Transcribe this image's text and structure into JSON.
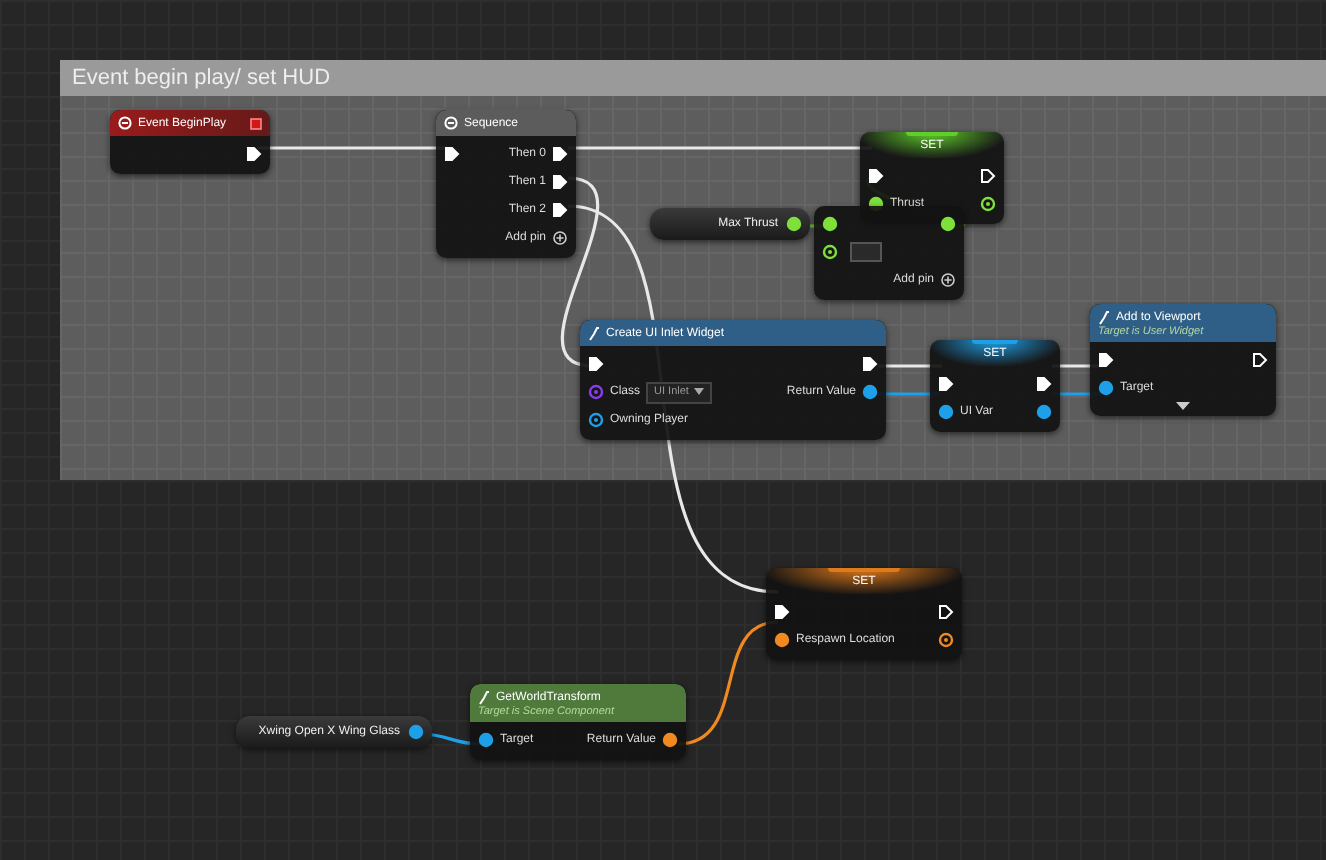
{
  "comment": {
    "title": "Event begin play/ set HUD"
  },
  "nodes": [
    {
      "kind": "event",
      "title": "Event BeginPlay",
      "color": "#9a1b1b",
      "outputs": [
        {
          "kind": "exec",
          "connected": true
        }
      ]
    },
    {
      "kind": "flow",
      "title": "Sequence",
      "color": "#5c5c5c",
      "inputs": [
        {
          "kind": "exec",
          "connected": true
        }
      ],
      "outputs": [
        {
          "kind": "exec",
          "label": "Then 0",
          "connected": true
        },
        {
          "kind": "exec",
          "label": "Then 1",
          "connected": true
        },
        {
          "kind": "exec",
          "label": "Then 2",
          "connected": true
        }
      ],
      "footer": "Add pin"
    },
    {
      "kind": "set",
      "title": "SET",
      "color": "#5fcf2a",
      "inputs": [
        {
          "kind": "exec",
          "connected": true
        },
        {
          "kind": "data",
          "label": "Thrust",
          "color": "#7ee03a",
          "connected": true
        }
      ],
      "outputs": [
        {
          "kind": "exec",
          "connected": false
        },
        {
          "kind": "data",
          "color": "#7ee03a",
          "connected": false
        }
      ]
    },
    {
      "kind": "variable",
      "title": "Max Thrust",
      "outputs": [
        {
          "kind": "data",
          "color": "#7ee03a",
          "connected": true
        }
      ]
    },
    {
      "kind": "math",
      "inputs": [
        {
          "kind": "data",
          "color": "#7ee03a",
          "connected": true
        },
        {
          "kind": "data",
          "color": "#7ee03a",
          "connected": false,
          "field": true
        }
      ],
      "outputs": [
        {
          "kind": "data",
          "color": "#7ee03a",
          "connected": true
        }
      ],
      "footer": "Add pin"
    },
    {
      "kind": "function",
      "title": "Create UI Inlet Widget",
      "color": "#2f5f86",
      "inputs": [
        {
          "kind": "exec",
          "connected": true
        },
        {
          "kind": "data",
          "label": "Class",
          "color": "#8a3cf0",
          "connected": false,
          "value": "UI Inlet"
        },
        {
          "kind": "data",
          "label": "Owning Player",
          "color": "#1ea0e8",
          "connected": false
        }
      ],
      "outputs": [
        {
          "kind": "exec",
          "connected": true
        },
        {
          "kind": "data",
          "label": "Return Value",
          "color": "#1ea0e8",
          "connected": true
        }
      ]
    },
    {
      "kind": "set",
      "title": "SET",
      "color": "#1ea0e8",
      "inputs": [
        {
          "kind": "exec",
          "connected": true
        },
        {
          "kind": "data",
          "label": "UI Var",
          "color": "#1ea0e8",
          "connected": true
        }
      ],
      "outputs": [
        {
          "kind": "exec",
          "connected": true
        },
        {
          "kind": "data",
          "color": "#1ea0e8",
          "connected": true
        }
      ]
    },
    {
      "kind": "function",
      "title": "Add to Viewport",
      "subtitle": "Target is User Widget",
      "color": "#2f5f86",
      "inputs": [
        {
          "kind": "exec",
          "connected": true
        },
        {
          "kind": "data",
          "label": "Target",
          "color": "#1ea0e8",
          "connected": true
        }
      ],
      "outputs": [
        {
          "kind": "exec",
          "connected": false
        }
      ],
      "expander": true
    },
    {
      "kind": "set",
      "title": "SET",
      "color": "#e07a1a",
      "inputs": [
        {
          "kind": "exec",
          "connected": true
        },
        {
          "kind": "data",
          "label": "Respawn Location",
          "color": "#f08a20",
          "connected": true
        }
      ],
      "outputs": [
        {
          "kind": "exec",
          "connected": false
        },
        {
          "kind": "data",
          "color": "#f08a20",
          "connected": false
        }
      ]
    },
    {
      "kind": "function",
      "title": "GetWorldTransform",
      "subtitle": "Target is Scene Component",
      "color": "#4f7a3c",
      "inputs": [
        {
          "kind": "data",
          "label": "Target",
          "color": "#1ea0e8",
          "connected": true
        }
      ],
      "outputs": [
        {
          "kind": "data",
          "label": "Return Value",
          "color": "#f08a20",
          "connected": true
        }
      ]
    },
    {
      "kind": "variable",
      "title": "Xwing Open X Wing Glass",
      "outputs": [
        {
          "kind": "data",
          "color": "#1ea0e8",
          "connected": true
        }
      ]
    }
  ]
}
